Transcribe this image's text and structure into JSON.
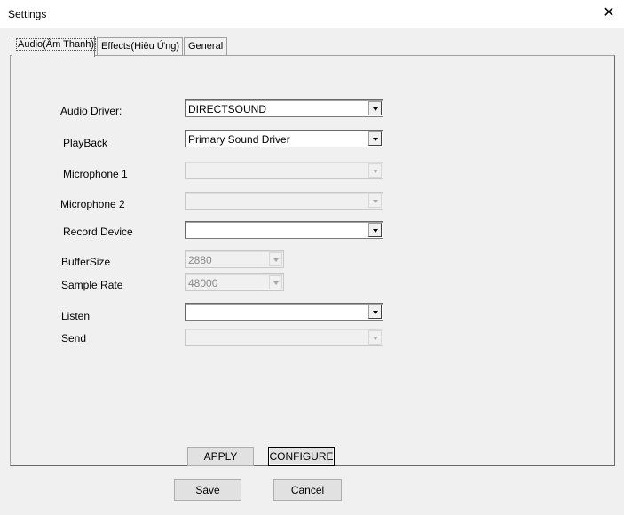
{
  "window": {
    "title": "Settings",
    "close_glyph": "✕"
  },
  "tabs": [
    {
      "label": "Audio(Âm Thanh)"
    },
    {
      "label": "Effects(Hiệu Ứng)"
    },
    {
      "label": "General"
    }
  ],
  "audio": {
    "audio_driver": {
      "label": "Audio Driver:",
      "value": "DIRECTSOUND"
    },
    "playback": {
      "label": "PlayBack",
      "value": "Primary Sound Driver"
    },
    "microphone1": {
      "label": "Microphone 1",
      "value": ""
    },
    "microphone2": {
      "label": "Microphone 2",
      "value": ""
    },
    "record_device": {
      "label": "Record Device",
      "value": ""
    },
    "buffer_size": {
      "label": "BufferSize",
      "value": "2880"
    },
    "sample_rate": {
      "label": "Sample Rate",
      "value": "48000"
    },
    "listen": {
      "label": "Listen",
      "value": ""
    },
    "send": {
      "label": "Send",
      "value": ""
    }
  },
  "panel_buttons": {
    "apply": "APPLY",
    "configure": "CONFIGURE"
  },
  "footer_buttons": {
    "save": "Save",
    "cancel": "Cancel"
  }
}
